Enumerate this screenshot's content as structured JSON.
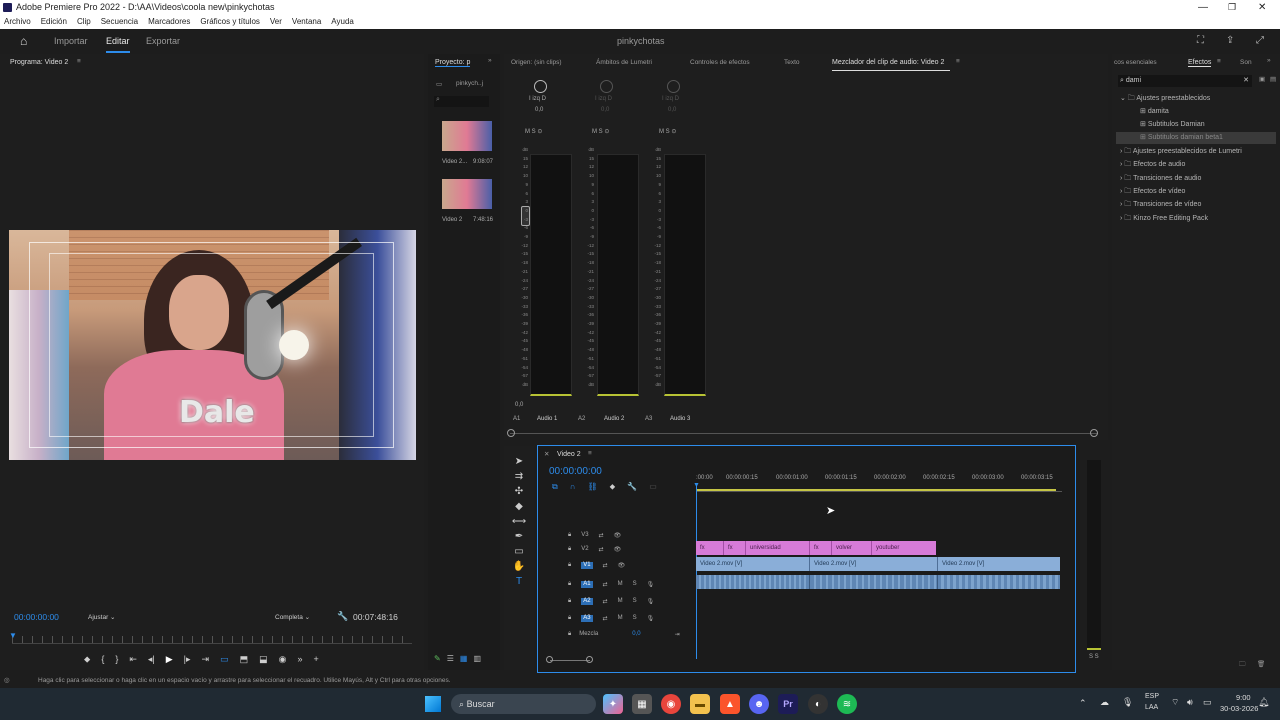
{
  "window": {
    "title": "Adobe Premiere Pro 2022 - D:\\AA\\Videos\\coola new\\pinkychotas",
    "menu": [
      "Archivo",
      "Edición",
      "Clip",
      "Secuencia",
      "Marcadores",
      "Gráficos y títulos",
      "Ver",
      "Ventana",
      "Ayuda"
    ]
  },
  "header": {
    "tabs": [
      "Importar",
      "Editar",
      "Exportar"
    ],
    "active_tab": "Editar",
    "project_name": "pinkychotas"
  },
  "program": {
    "title": "Programa: Video 2",
    "caption": "Dale",
    "timecode": "00:00:00:00",
    "fit": "Ajustar",
    "quality": "Completa",
    "duration": "00:07:48:16"
  },
  "project": {
    "tab": "Proyecto: p",
    "file": "pinkych..j",
    "items": [
      {
        "name": "Video 2...",
        "duration": "9:08:07"
      },
      {
        "name": "Video 2",
        "duration": "7:48:16"
      }
    ]
  },
  "mixer": {
    "tabs": [
      "Origen: (sin clips)",
      "Ámbitos de Lumetri",
      "Controles de efectos",
      "Texto",
      "Mezclador del clip de audio: Video 2"
    ],
    "channels": [
      {
        "id": "A1",
        "name": "Audio 1",
        "value": "0,0",
        "lr": "I izq D"
      },
      {
        "id": "A2",
        "name": "Audio 2",
        "value": "0,0",
        "lr": "I izq D"
      },
      {
        "id": "A3",
        "name": "Audio 3",
        "value": "0,0",
        "lr": "I izq D"
      }
    ],
    "scale": [
      "dB",
      "15",
      "12",
      "10",
      "9",
      "6",
      "3",
      "0",
      "-3",
      "-6",
      "-9",
      "-12",
      "-15",
      "-18",
      "-21",
      "-24",
      "-27",
      "-30",
      "-33",
      "-36",
      "-39",
      "-42",
      "-45",
      "-48",
      "-51",
      "-54",
      "-57",
      "dB"
    ],
    "bottom_value": "0,0"
  },
  "timeline": {
    "title": "Video 2",
    "timecode": "00:00:00:00",
    "ruler": [
      ":00:00",
      "00:00:00:15",
      "00:00:01:00",
      "00:00:01:15",
      "00:00:02:00",
      "00:00:02:15",
      "00:00:03:00",
      "00:00:03:15"
    ],
    "tracks": [
      "V3",
      "V2",
      "V1",
      "A1",
      "A2",
      "A3"
    ],
    "mix_label": "Mezcla",
    "mix_value": "0,0",
    "v2_clips": [
      "fx",
      "fx",
      "universidad",
      "fx",
      "volver",
      "youtuber"
    ],
    "v1_clips": [
      "Video 2.mov [V]",
      "Video 2.mov [V]",
      "Video 2.mov [V]"
    ]
  },
  "effects": {
    "tabs": [
      "cos esenciales",
      "Efectos",
      "Son"
    ],
    "search": "dami",
    "tree": [
      {
        "label": "Ajustes preestablecidos",
        "level": 0,
        "open": true
      },
      {
        "label": "damita",
        "level": 1
      },
      {
        "label": "Subtitulos Damian",
        "level": 1
      },
      {
        "label": "Subtitulos damian beta1",
        "level": 1,
        "selected": true
      },
      {
        "label": "Ajustes preestablecidos de Lumetri",
        "level": 0
      },
      {
        "label": "Efectos de audio",
        "level": 0
      },
      {
        "label": "Transiciones de audio",
        "level": 0
      },
      {
        "label": "Efectos de vídeo",
        "level": 0
      },
      {
        "label": "Transiciones de vídeo",
        "level": 0
      },
      {
        "label": "Kinzo Free Editing Pack",
        "level": 0
      }
    ]
  },
  "meter_right": {
    "label": "S S"
  },
  "status": {
    "text": "Haga clic para seleccionar o haga clic en un espacio vacío y arrastre para seleccionar el recuadro. Utilice Mayús, Alt y Ctrl para otras opciones."
  },
  "taskbar": {
    "search": "Buscar",
    "lang": "ESP",
    "layout": "LAA",
    "time": "9:00",
    "date": "30-03-2026"
  }
}
